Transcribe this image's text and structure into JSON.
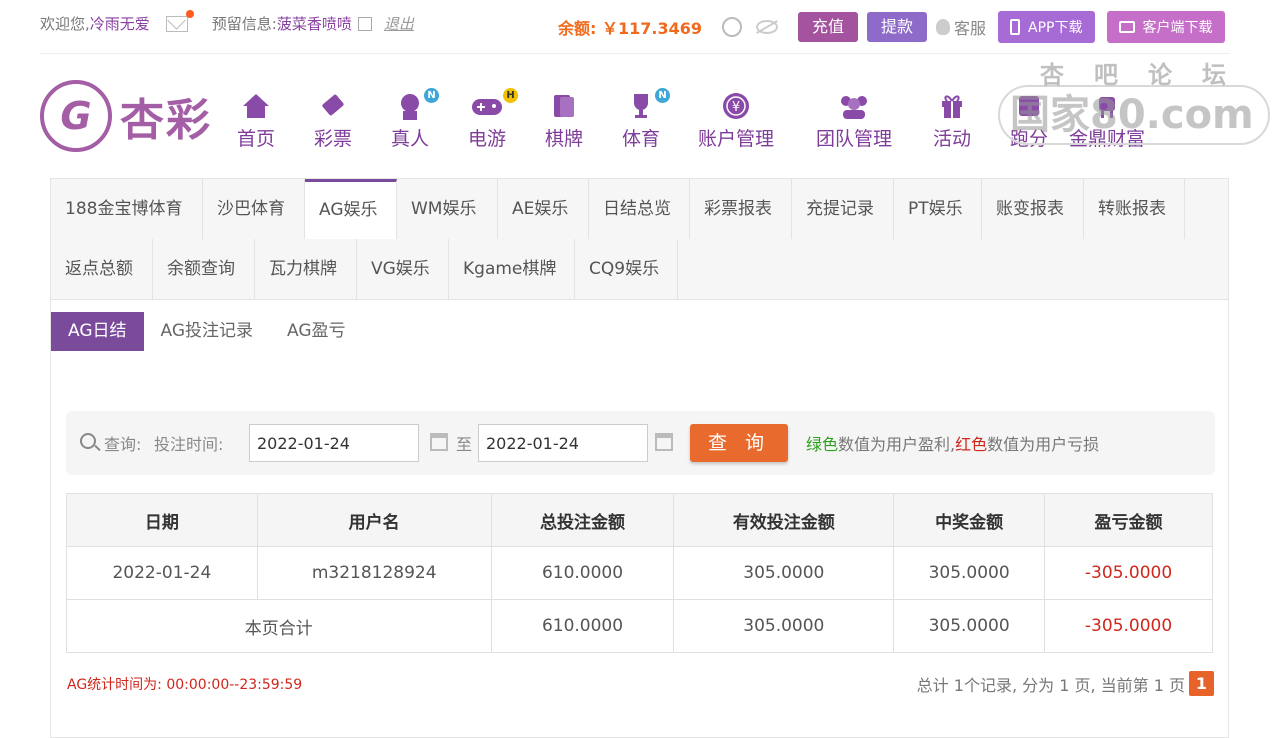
{
  "topbar": {
    "welcome_label": "欢迎您,",
    "username": "冷雨无爱",
    "reserved_label": "预留信息:",
    "reserved_value": "菠菜香喷喷",
    "logout": "退出",
    "balance": "余额: ￥117.3469",
    "recharge": "充值",
    "withdraw": "提款",
    "service": "客服",
    "app_download": "APP下载",
    "client_download": "客户端下载"
  },
  "logo": {
    "mark": "G",
    "name": "杏彩"
  },
  "nav": [
    {
      "label": "首页",
      "icon": "home-icon"
    },
    {
      "label": "彩票",
      "icon": "lottery-icon"
    },
    {
      "label": "真人",
      "icon": "live-dealer-icon",
      "tag": "N"
    },
    {
      "label": "电游",
      "icon": "gamepad-icon",
      "tag": "H"
    },
    {
      "label": "棋牌",
      "icon": "cards-icon"
    },
    {
      "label": "体育",
      "icon": "trophy-icon",
      "tag": "N"
    },
    {
      "label": "账户管理",
      "icon": "yen-coin-icon"
    },
    {
      "label": "团队管理",
      "icon": "team-icon"
    },
    {
      "label": "活动",
      "icon": "gift-icon"
    },
    {
      "label": "跑分",
      "icon": "run-icon"
    },
    {
      "label": "金鼎财富",
      "icon": "ding-icon"
    }
  ],
  "watermark": {
    "top": "杏吧论坛",
    "main": "国家80.com"
  },
  "tabs": [
    "188金宝博体育",
    "沙巴体育",
    "AG娱乐",
    "WM娱乐",
    "AE娱乐",
    "日结总览",
    "彩票报表",
    "充提记录",
    "PT娱乐",
    "账变报表",
    "转账报表",
    "返点总额",
    "余额查询",
    "瓦力棋牌",
    "VG娱乐",
    "Kgame棋牌",
    "CQ9娱乐"
  ],
  "active_tab": "AG娱乐",
  "subtabs": [
    "AG日结",
    "AG投注记录",
    "AG盈亏"
  ],
  "active_subtab": "AG日结",
  "query": {
    "label": "查询:",
    "time_label": "投注时间:",
    "start": "2022-01-24",
    "to": "至",
    "end": "2022-01-24",
    "button": "查 询",
    "note_green": "绿色",
    "note_mid": "数值为用户盈利,",
    "note_red": "红色",
    "note_end": "数值为用户亏损"
  },
  "table": {
    "headers": [
      "日期",
      "用户名",
      "总投注金额",
      "有效投注金额",
      "中奖金额",
      "盈亏金额"
    ],
    "row": [
      "2022-01-24",
      "m3218128924",
      "610.0000",
      "305.0000",
      "305.0000",
      "-305.0000"
    ],
    "total_label": "本页合计",
    "total": [
      "610.0000",
      "305.0000",
      "305.0000",
      "-305.0000"
    ]
  },
  "footer": {
    "stat_time": "AG统计时间为: 00:00:00--23:59:59",
    "pager_text": "总计 1个记录, 分为 1 页, 当前第 1 页",
    "current_page": "1"
  },
  "colors": {
    "accent": "#7b4b9b",
    "balance": "#f06a1c",
    "query_button": "#e86a2c",
    "profit": "#2fa01f",
    "loss": "#d0271d"
  }
}
